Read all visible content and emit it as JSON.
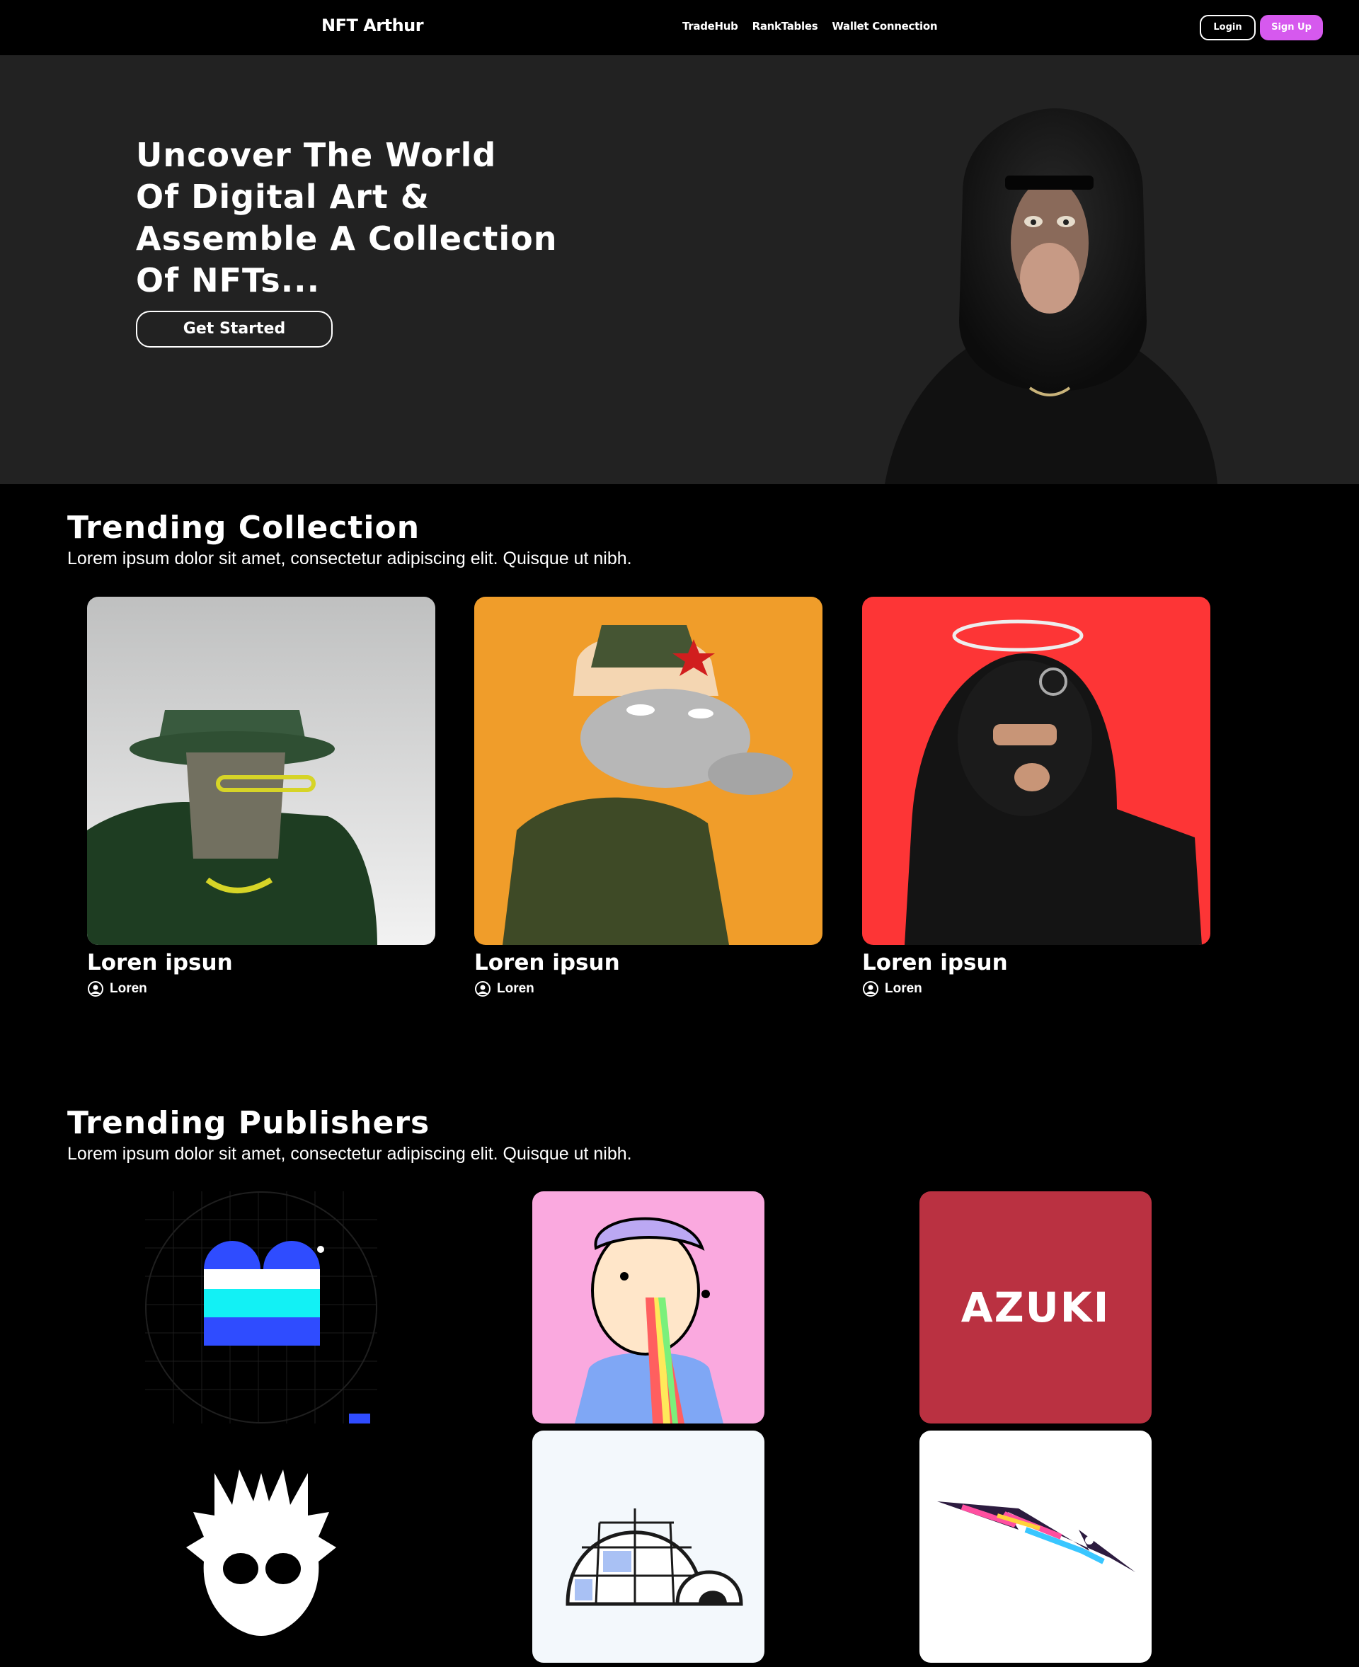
{
  "nav": {
    "brand": "NFT Arthur",
    "links": [
      "TradeHub",
      "RankTables",
      "Wallet Connection"
    ],
    "login": "Login",
    "signup": "Sign Up"
  },
  "hero": {
    "title_lines": [
      "Uncover The World",
      "Of Digital Art &",
      "Assemble A Collection",
      "Of NFTs..."
    ],
    "cta": "Get Started"
  },
  "trending_collection": {
    "title": "Trending Collection",
    "subtitle": "Lorem ipsum dolor sit amet, consectetur adipiscing elit. Quisque ut nibh.",
    "cards": [
      {
        "title": "Loren ipsun",
        "author": "Loren",
        "bg": "#e4e4e4"
      },
      {
        "title": "Loren ipsun",
        "author": "Loren",
        "bg": "#f09d2a"
      },
      {
        "title": "Loren ipsun",
        "author": "Loren",
        "bg": "#fd3536"
      }
    ]
  },
  "trending_publishers": {
    "title": "Trending Publishers",
    "subtitle": "Lorem ipsum dolor sit amet, consectetur adipiscing elit. Quisque ut nibh.",
    "logo_text": "AZUKI",
    "colors": {
      "pink": "#faa9df",
      "azuki_red": "#ba3141",
      "white": "#ffffff",
      "igloo_bg": "#f3f8fc"
    }
  }
}
